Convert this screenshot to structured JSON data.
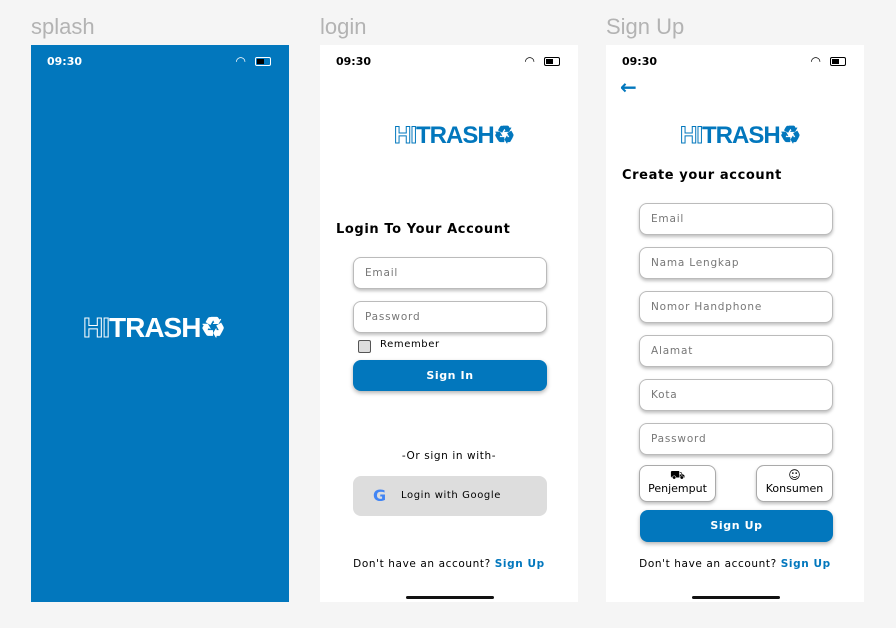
{
  "labels": {
    "splash": "splash",
    "login": "login",
    "signup": "Sign Up"
  },
  "status": {
    "time": "09:30"
  },
  "logo": {
    "hi": "HI",
    "trash": "TRASH"
  },
  "colors": {
    "brand": "#0277bd",
    "google_button": "#dddddd"
  },
  "login": {
    "title": "Login To Your Account",
    "email_placeholder": "Email",
    "password_placeholder": "Password",
    "remember": "Remember",
    "sign_in": "Sign In",
    "or": "-Or sign in with-",
    "google": "Login with Google",
    "footer_text": "Don't have an account? ",
    "footer_link": "Sign Up"
  },
  "signup": {
    "title": "Create your account",
    "fields": [
      "Email",
      "Nama Lengkap",
      "Nomor Handphone",
      "Alamat",
      "Kota",
      "Password"
    ],
    "roles": [
      "Penjemput",
      "Konsumen"
    ],
    "sign_up": "Sign Up",
    "footer_text": "Don't have an account? ",
    "footer_link": "Sign Up"
  }
}
